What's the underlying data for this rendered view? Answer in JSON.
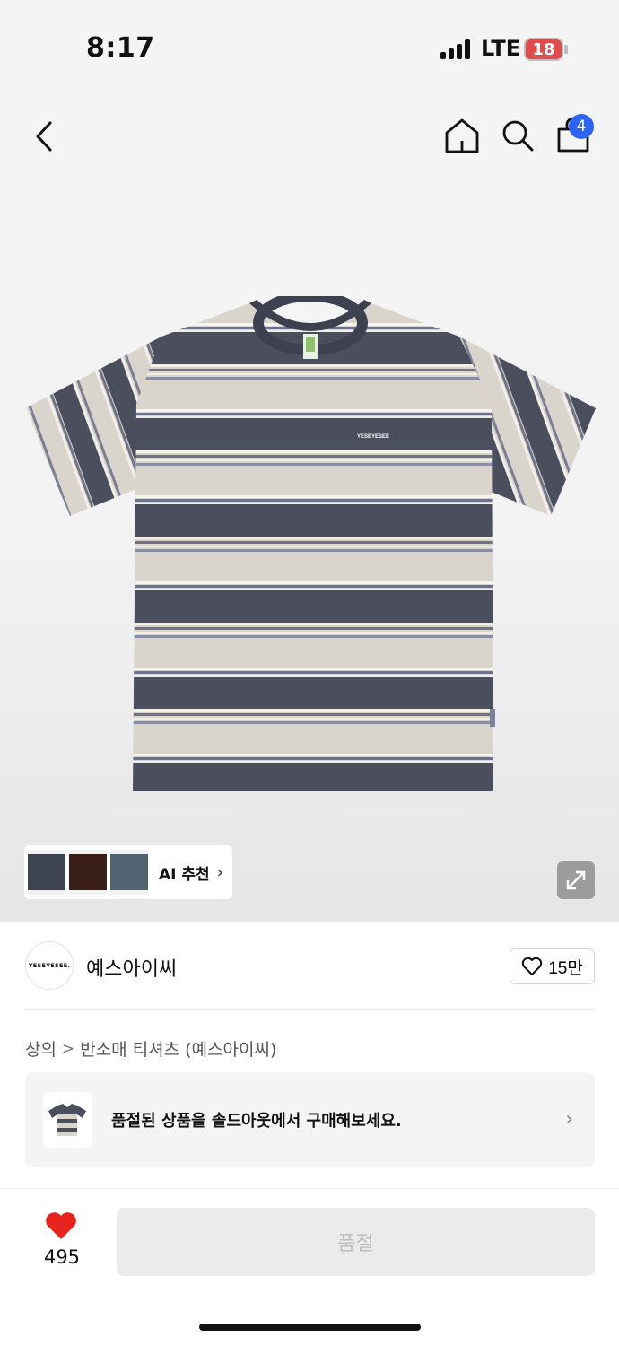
{
  "status_bar": {
    "time": "8:17",
    "network": "LTE",
    "battery": "18"
  },
  "nav": {
    "cart_count": "4",
    "icons": [
      "back-icon",
      "home-icon",
      "search-icon",
      "shopping-bag-icon"
    ]
  },
  "product_image": {
    "print_text": "YESEYESEE",
    "colors": {
      "stripe_dark": "#4a4d5c",
      "stripe_light": "#d8d4cc"
    }
  },
  "ai_recommend": {
    "label": "AI 추천",
    "chevron": "›"
  },
  "brand": {
    "logo_text": "YESEYESEE.",
    "name": "예스아이씨",
    "likes": "15만"
  },
  "breadcrumb": {
    "level1": "상의",
    "separator": ">",
    "level2": "반소매 티셔츠 (예스아이씨)"
  },
  "soldout_banner": {
    "text": "품절된 상품을 솔드아웃에서 구매해보세요.",
    "chevron": "›"
  },
  "bottom_bar": {
    "like_count": "495",
    "button_label": "품절",
    "heart_color": "#e8231e"
  }
}
